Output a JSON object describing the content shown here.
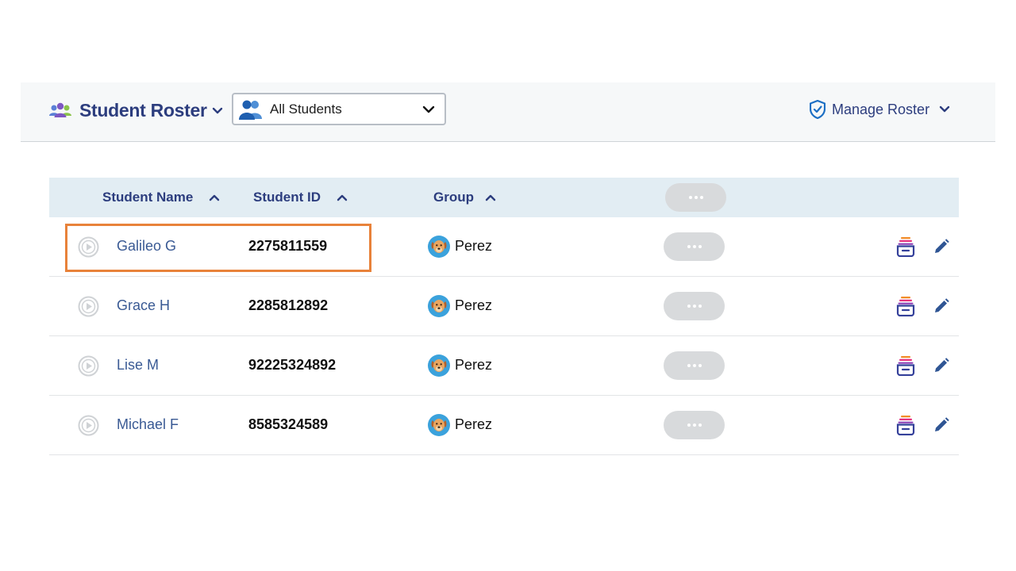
{
  "header": {
    "title": "Student Roster",
    "title_icon": "people-group-icon",
    "filter": {
      "value": "All Students",
      "icon": "users-icon"
    },
    "manage": {
      "label": "Manage Roster",
      "icon": "shield-check-icon"
    }
  },
  "table": {
    "columns": [
      "Student Name",
      "Student ID",
      "Group"
    ],
    "rows": [
      {
        "name": "Galileo G",
        "id": "2275811559",
        "group": "Perez"
      },
      {
        "name": "Grace H",
        "id": "2285812892",
        "group": "Perez"
      },
      {
        "name": "Lise M",
        "id": "92225324892",
        "group": "Perez"
      },
      {
        "name": "Michael F",
        "id": "8585324589",
        "group": "Perez"
      }
    ],
    "row_icons": [
      "play-icon",
      "dog-avatar-icon",
      "more-icon",
      "tray-icon",
      "pencil-icon"
    ]
  },
  "colors": {
    "brand": "#2c3d7e",
    "link": "#3a5a94",
    "header_row_bg": "#e2edf3",
    "highlight": "#e8823a"
  }
}
